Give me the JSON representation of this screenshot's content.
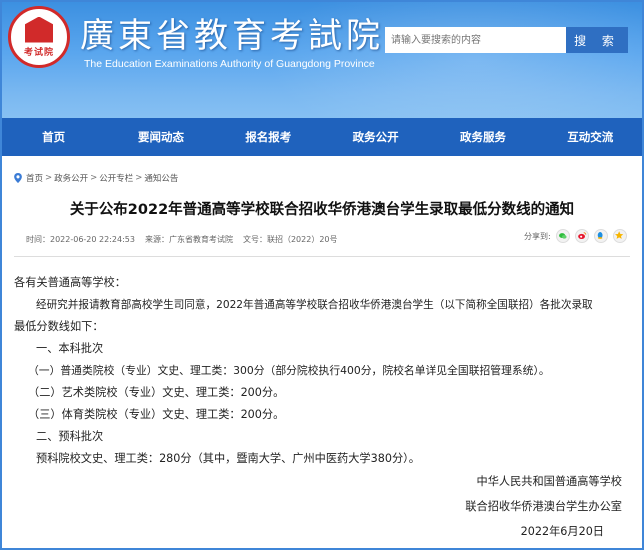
{
  "header": {
    "logo_text": "考试院",
    "title": "廣東省教育考試院",
    "subtitle": "The Education Examinations Authority of Guangdong Province",
    "search_placeholder": "请输入要搜索的内容",
    "search_button": "搜 索",
    "colors": {
      "header_blue": "#3b8fe0",
      "nav_blue": "#1f62bd",
      "logo_red": "#d12a2a"
    }
  },
  "nav": {
    "items": [
      "首页",
      "要闻动态",
      "报名报考",
      "政务公开",
      "政务服务",
      "互动交流"
    ]
  },
  "breadcrumb": {
    "items": [
      "首页",
      "政务公开",
      "公开专栏",
      "通知公告"
    ]
  },
  "article": {
    "title": "关于公布2022年普通高等学校联合招收华侨港澳台学生录取最低分数线的通知",
    "time": "时间：2022-06-20 22:24:53",
    "source": "来源：广东省教育考试院",
    "doc_no": "文号：联招（2022）20号",
    "share_label": "分享到:",
    "share_icons": [
      "wechat-icon",
      "weibo-icon",
      "qq-icon",
      "qzone-icon"
    ],
    "body": {
      "greeting": "各有关普通高等学校：",
      "intro_line1": "经研究并报请教育部高校学生司同意，2022年普通高等学校联合招收华侨港澳台学生（以下简称全国联招）各批次录取",
      "intro_line2": "最低分数线如下：",
      "section1": "一、本科批次",
      "item1": "（一）普通类院校（专业）文史、理工类：300分（部分院校执行400分，院校名单详见全国联招管理系统）。",
      "item2": "（二）艺术类院校（专业）文史、理工类：200分。",
      "item3": "（三）体育类院校（专业）文史、理工类：200分。",
      "section2": "二、预科批次",
      "prep": "预科院校文史、理工类：280分（其中，暨南大学、广州中医药大学380分）。"
    },
    "signature": {
      "line1": "中华人民共和国普通高等学校",
      "line2": "联合招收华侨港澳台学生办公室",
      "date": "2022年6月20日"
    }
  }
}
